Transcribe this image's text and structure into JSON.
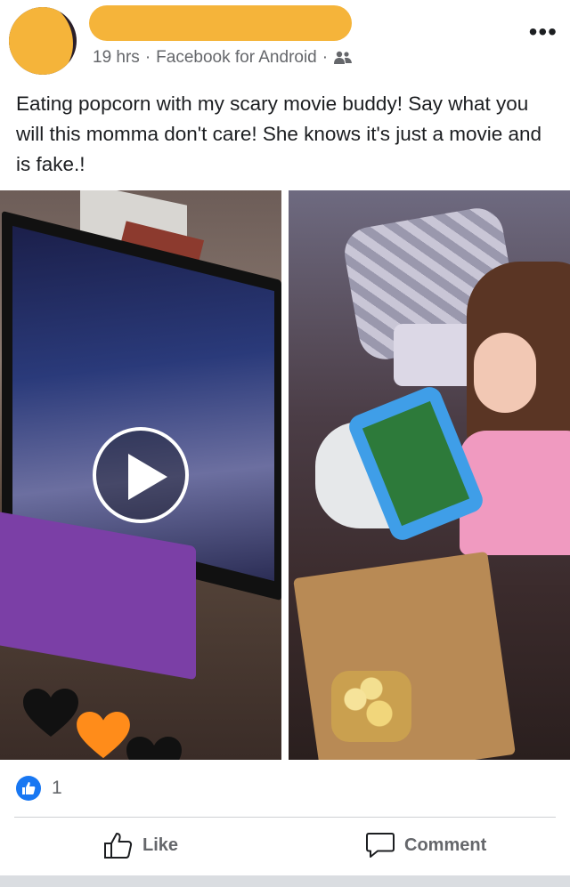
{
  "header": {
    "timestamp": "19 hrs",
    "separator": "·",
    "source": "Facebook for Android",
    "separator2": "·",
    "audience_icon": "friends-icon",
    "more_icon": "more-icon",
    "more_label": "•••"
  },
  "post": {
    "text": "Eating popcorn with my scary movie buddy! Say what you will this momma don't care! She knows it's just a movie and is fake.!"
  },
  "media": {
    "play_icon": "play-icon",
    "heart_colors": [
      "#111111",
      "#ff8c1a",
      "#111111",
      "#ff8c1a"
    ]
  },
  "reactions": {
    "like_icon": "like-badge-icon",
    "count": "1"
  },
  "actions": {
    "like_label": "Like",
    "comment_label": "Comment"
  },
  "colors": {
    "accent": "#1877f2",
    "redaction": "#f5b43a",
    "secondary_text": "#65676b"
  }
}
